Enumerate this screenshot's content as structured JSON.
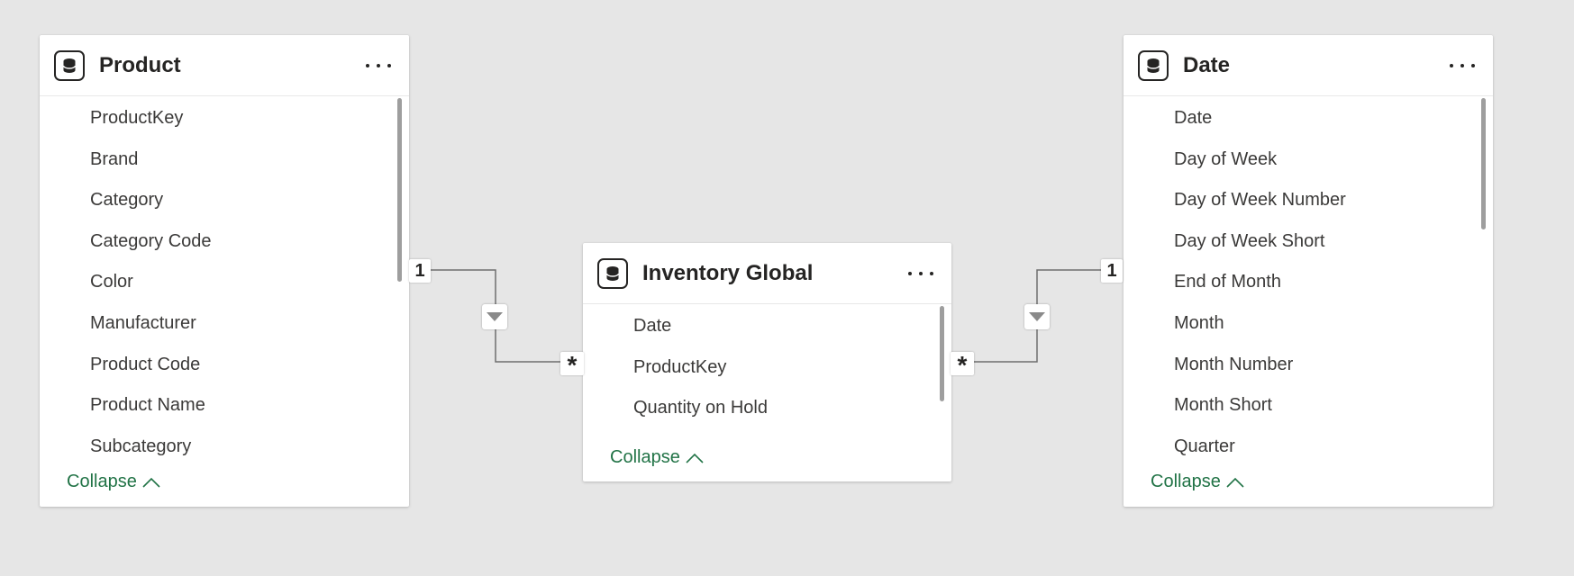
{
  "tables": {
    "product": {
      "icon": "table-icon",
      "title": "Product",
      "fields": [
        "ProductKey",
        "Brand",
        "Category",
        "Category Code",
        "Color",
        "Manufacturer",
        "Product Code",
        "Product Name",
        "Subcategory"
      ],
      "collapse_label": "Collapse"
    },
    "inventory": {
      "icon": "table-icon",
      "title": "Inventory Global",
      "fields": [
        "Date",
        "ProductKey",
        "Quantity on Hold"
      ],
      "collapse_label": "Collapse"
    },
    "date": {
      "icon": "table-icon",
      "title": "Date",
      "fields": [
        "Date",
        "Day of Week",
        "Day of Week Number",
        "Day of Week Short",
        "End of Month",
        "Month",
        "Month Number",
        "Month Short",
        "Quarter"
      ],
      "collapse_label": "Collapse"
    }
  },
  "relationships": [
    {
      "from": "Product",
      "to": "Inventory Global",
      "from_cardinality": "1",
      "to_cardinality": "*",
      "filter_direction": "single"
    },
    {
      "from": "Date",
      "to": "Inventory Global",
      "from_cardinality": "1",
      "to_cardinality": "*",
      "filter_direction": "single"
    }
  ],
  "colors": {
    "canvas": "#e6e6e6",
    "card": "#ffffff",
    "collapse_link": "#217346",
    "relationship_line": "#6e6e6e"
  }
}
